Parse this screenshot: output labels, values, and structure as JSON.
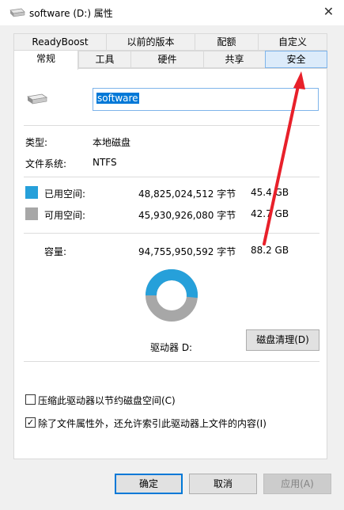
{
  "window": {
    "title": "software (D:) 属性",
    "close_glyph": "✕"
  },
  "tabs": {
    "row1": [
      "ReadyBoost",
      "以前的版本",
      "配额",
      "自定义"
    ],
    "row2": [
      "常规",
      "工具",
      "硬件",
      "共享",
      "安全"
    ],
    "active": "常规",
    "highlighted": "安全"
  },
  "general": {
    "volume_name": "software",
    "type_label": "类型:",
    "type_value": "本地磁盘",
    "fs_label": "文件系统:",
    "fs_value": "NTFS",
    "used": {
      "label": "已用空间:",
      "bytes": "48,825,024,512 字节",
      "size": "45.4 GB",
      "color": "#26a0da"
    },
    "free": {
      "label": "可用空间:",
      "bytes": "45,930,926,080 字节",
      "size": "42.7 GB",
      "color": "#a7a7a7"
    },
    "capacity": {
      "label": "容量:",
      "bytes": "94,755,950,592 字节",
      "size": "88.2 GB"
    },
    "used_fraction": 0.515,
    "drive_label": "驱动器 D:",
    "cleanup_button": "磁盘清理(D)",
    "compress_label": "压缩此驱动器以节约磁盘空间(C)",
    "compress_checked": false,
    "index_label": "除了文件属性外，还允许索引此驱动器上文件的内容(I)",
    "index_checked": true
  },
  "buttons": {
    "ok": "确定",
    "cancel": "取消",
    "apply": "应用(A)"
  },
  "annotation_color": "#e8202a"
}
